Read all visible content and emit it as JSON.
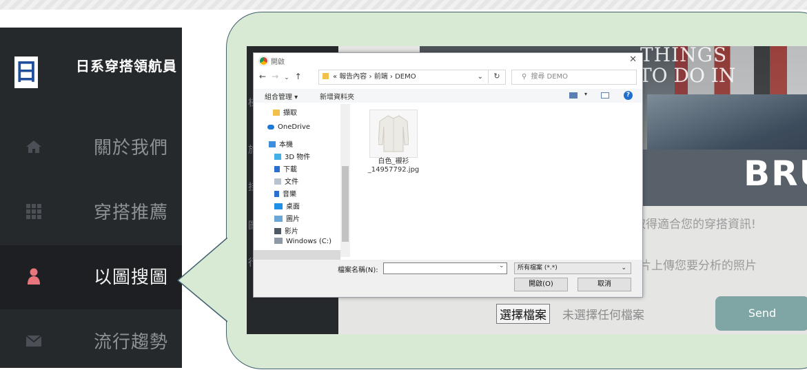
{
  "sidebar": {
    "brand": "日系穿搭領航員",
    "logo_char": "日",
    "items": [
      {
        "label": "關於我們",
        "icon": "home-icon"
      },
      {
        "label": "穿搭推薦",
        "icon": "grid-icon"
      },
      {
        "label": "以圖搜圖",
        "icon": "user-icon",
        "active": true
      },
      {
        "label": "流行趨勢",
        "icon": "envelope-icon"
      }
    ]
  },
  "app": {
    "side_chars": [
      "梯",
      "旅",
      "挂",
      "圖",
      "行"
    ],
    "hero_text_1": "THINGS",
    "hero_text_2": "TO DO IN",
    "hero_brand": "BRUTU",
    "caption_1": "取得適合您的穿搭資訊!",
    "caption_2": "片上傳您要分析的照片",
    "file_button": "選擇檔案",
    "file_status": "未選擇任何檔案",
    "send_button": "Send"
  },
  "dialog": {
    "title": "開啟",
    "close": "✕",
    "path": [
      "«",
      "報告內容",
      "›",
      "前端",
      "›",
      "DEMO"
    ],
    "search_placeholder": "搜尋 DEMO",
    "toolbar": {
      "organize": "組合管理 ▾",
      "new_folder": "新增資料夾"
    },
    "tree": [
      {
        "label": "擷取",
        "icon": "folder-icon"
      },
      {
        "label": "OneDrive",
        "icon": "cloud-icon"
      },
      {
        "label": "本機",
        "icon": "computer-icon"
      },
      {
        "label": "3D 物件",
        "icon": "cube-icon"
      },
      {
        "label": "下載",
        "icon": "download-icon"
      },
      {
        "label": "文件",
        "icon": "document-icon"
      },
      {
        "label": "音樂",
        "icon": "music-icon"
      },
      {
        "label": "桌面",
        "icon": "desktop-icon",
        "selected": true
      },
      {
        "label": "圖片",
        "icon": "picture-icon"
      },
      {
        "label": "影片",
        "icon": "video-icon"
      },
      {
        "label": "Windows (C:)",
        "icon": "drive-icon"
      }
    ],
    "file": {
      "name_line1": "白色_襯衫",
      "name_line2": "_14957792.jpg"
    },
    "filename_label": "檔案名稱(N):",
    "filename_value": "",
    "filter": "所有檔案 (*.*)",
    "open_button": "開啟(O)",
    "cancel_button": "取消"
  },
  "colors": {
    "sidebar_bg": "#26292c",
    "bubble_bg": "#d9ead4",
    "active_icon": "#e8747c",
    "send_bg": "#7fa6a4"
  }
}
